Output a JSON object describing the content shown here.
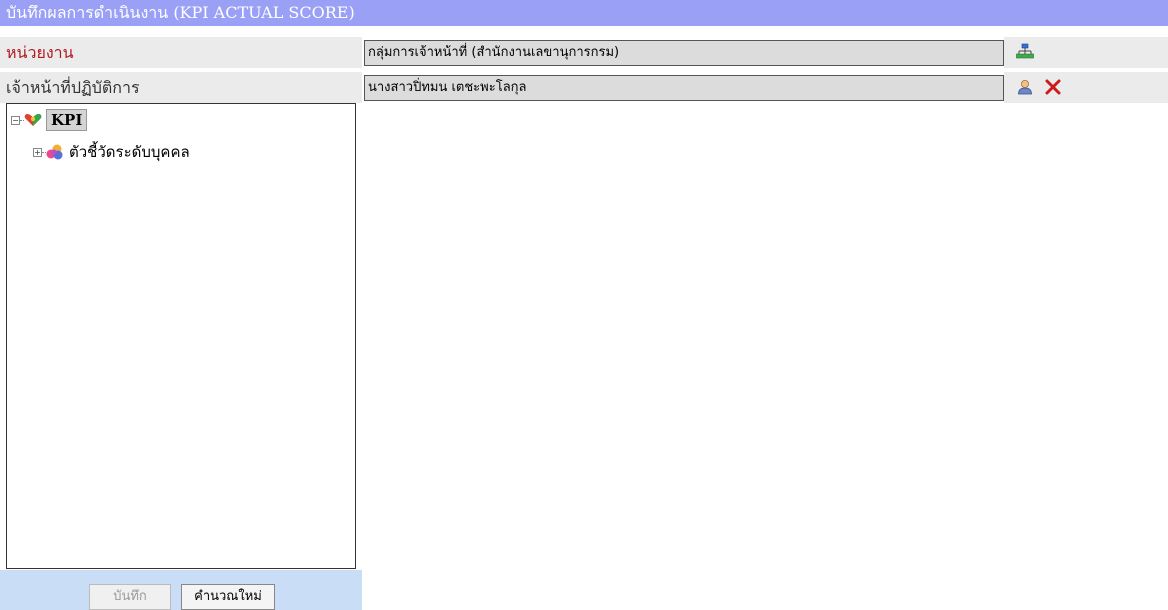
{
  "header": {
    "title": "บันทึกผลการดำเนินงาน (KPI ACTUAL SCORE)"
  },
  "unit_row": {
    "label": "หน่วยงาน",
    "value": "กลุ่มการเจ้าหน้าที่ (สำนักงานเลขานุการกรม)",
    "icon": "org-chart-icon"
  },
  "staff_row": {
    "label": "เจ้าหน้าที่ปฏิบัติการ",
    "value": "นางสาวปิ่ทมน เตชะพะโลกุล",
    "icons": [
      "person-icon",
      "close-icon"
    ]
  },
  "tree": {
    "root": {
      "label": "KPI",
      "expander": "−",
      "icon": "kpi-heart-icon"
    },
    "children": [
      {
        "label": "ตัวชี้วัดระดับบุคคล",
        "expander": "+",
        "icon": "colorful-cubes-icon"
      }
    ]
  },
  "buttons": {
    "save": "บันทึก",
    "recalculate": "คำนวณใหม่"
  },
  "colors": {
    "titlebar": "#9aa0f5",
    "unit_label": "#b0191f",
    "bottombar": "#c9ddf7"
  }
}
